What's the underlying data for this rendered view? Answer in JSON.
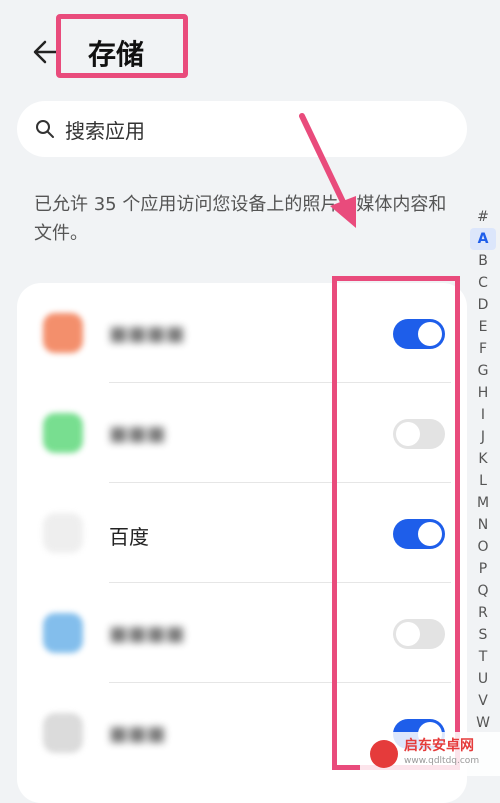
{
  "header": {
    "title": "存储",
    "back_icon": "arrow-left-icon"
  },
  "search": {
    "placeholder": "搜索应用"
  },
  "description": "已允许 35 个应用访问您设备上的照片、媒体内容和文件。",
  "apps": [
    {
      "name": "■■■■",
      "icon_color": "#f06a3c",
      "enabled": true
    },
    {
      "name": "■■■",
      "icon_color": "#4bd46b",
      "enabled": false
    },
    {
      "name": "百度",
      "icon_color": "#e9e9e9",
      "enabled": true
    },
    {
      "name": "■■■■",
      "icon_color": "#5aa9e6",
      "enabled": false
    },
    {
      "name": "■■■",
      "icon_color": "#cfcfcf",
      "enabled": true
    }
  ],
  "alphabet": [
    "#",
    "A",
    "B",
    "C",
    "D",
    "E",
    "F",
    "G",
    "H",
    "I",
    "J",
    "K",
    "L",
    "M",
    "N",
    "O",
    "P",
    "Q",
    "R",
    "S",
    "T",
    "U",
    "V",
    "W"
  ],
  "alphabet_active": "A",
  "colors": {
    "accent": "#1e5eea",
    "annotation": "#e94b7c"
  },
  "watermark": {
    "name": "启东安卓网",
    "url": "www.qdltdq.com"
  }
}
